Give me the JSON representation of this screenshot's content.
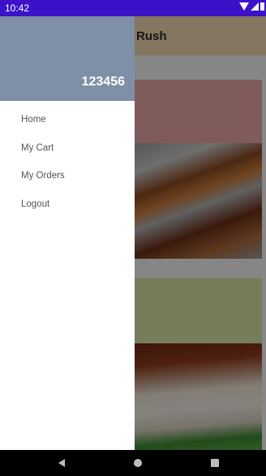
{
  "status_bar": {
    "time": "10:42"
  },
  "toolbar": {
    "title": "Rush"
  },
  "drawer": {
    "header_text": "123456",
    "items": [
      {
        "label": "Home"
      },
      {
        "label": "My Cart"
      },
      {
        "label": "My Orders"
      },
      {
        "label": "Logout"
      }
    ]
  },
  "icons": {
    "status": [
      "wifi-icon",
      "signal-icon",
      "battery-icon"
    ],
    "nav": [
      "back-icon",
      "home-icon",
      "recents-icon"
    ]
  },
  "colors": {
    "status_bar": "#3b12c8",
    "drawer_header": "#7f8fa6",
    "toolbar": "#f0d7b0",
    "card1": "#e8a6a6",
    "card2": "#d7e3a6"
  }
}
